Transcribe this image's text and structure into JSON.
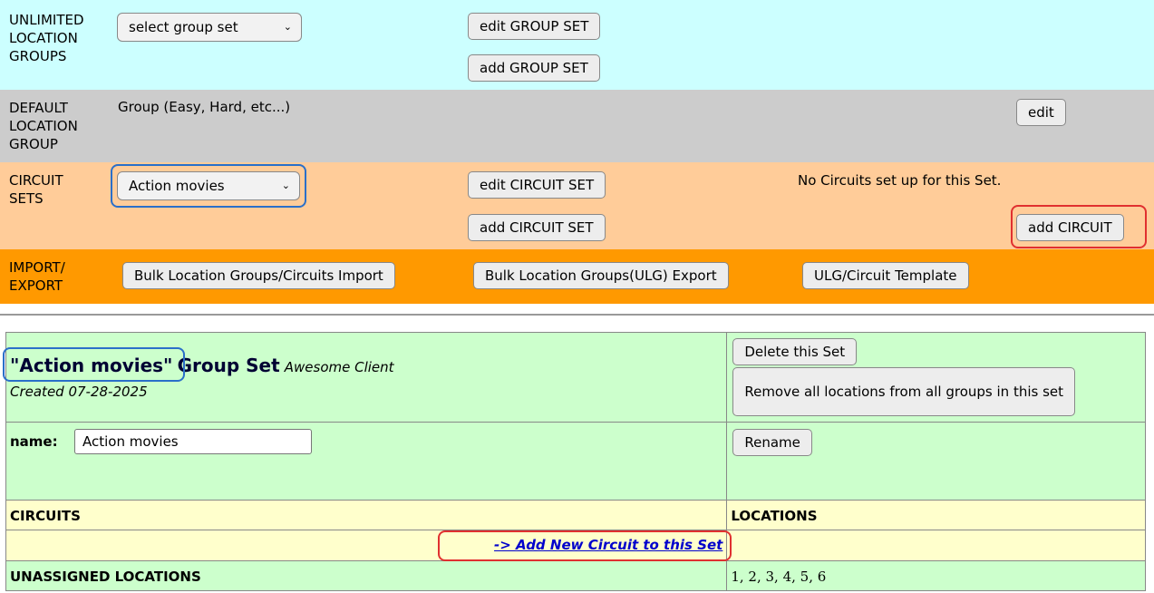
{
  "unlimited": {
    "label_lines": [
      "UNLIMITED",
      "LOCATION",
      "GROUPS"
    ],
    "select_value": "select group set",
    "edit_btn": "edit GROUP SET",
    "add_btn": "add GROUP SET"
  },
  "default_group": {
    "label_lines": [
      "DEFAULT",
      "LOCATION",
      "GROUP"
    ],
    "value": "Group (Easy, Hard, etc...)",
    "edit_btn": "edit"
  },
  "circuit_sets": {
    "label_lines": [
      "CIRCUIT",
      "SETS"
    ],
    "select_value": "Action movies",
    "edit_btn": "edit CIRCUIT SET",
    "add_btn": "add CIRCUIT SET",
    "status": "No Circuits set up for this Set.",
    "add_circuit_btn": "add CIRCUIT"
  },
  "import_export": {
    "label_lines": [
      "IMPORT/",
      "EXPORT"
    ],
    "bulk_import_btn": "Bulk Location Groups/Circuits Import",
    "bulk_export_btn": "Bulk Location Groups(ULG) Export",
    "template_btn": "ULG/Circuit Template"
  },
  "group_set": {
    "title_quoted": "\"Action movies\"",
    "title_suffix": "Group Set",
    "client": "Awesome Client",
    "created": "Created 07-28-2025",
    "delete_btn": "Delete this Set",
    "remove_btn": "Remove all locations from all groups in this set",
    "name_label": "name:",
    "name_value": "Action movies",
    "rename_btn": "Rename",
    "circuits_header": "CIRCUITS",
    "locations_header": "LOCATIONS",
    "add_circuit_link": "-> Add New Circuit to this Set",
    "unassigned_label": "UNASSIGNED LOCATIONS",
    "unassigned_values": "1, 2, 3, 4, 5, 6"
  },
  "colors": {
    "unlimited_bg": "#ccffff",
    "default_bg": "#cccccc",
    "circuit_bg": "#ffcc99",
    "import_bg": "#ff9900",
    "table_green": "#ccffcc",
    "table_yellow": "#ffffcc",
    "highlight_blue": "#2a6fc9",
    "highlight_red": "#e03030"
  }
}
